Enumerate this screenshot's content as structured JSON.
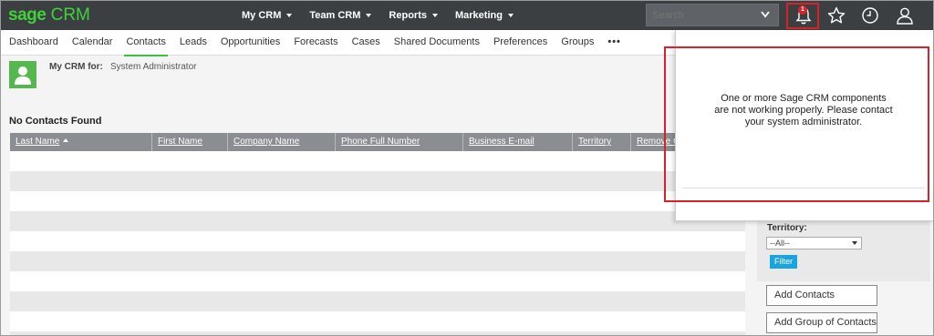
{
  "app": {
    "brand_sage": "sage",
    "brand_crm": "CRM"
  },
  "topmenu": [
    {
      "label": "My CRM"
    },
    {
      "label": "Team CRM"
    },
    {
      "label": "Reports"
    },
    {
      "label": "Marketing"
    }
  ],
  "search": {
    "placeholder": "Search"
  },
  "notifications": {
    "count": "1",
    "message": "One or more Sage CRM components are not working properly. Please contact your system administrator."
  },
  "tabs": [
    {
      "label": "Dashboard"
    },
    {
      "label": "Calendar"
    },
    {
      "label": "Contacts"
    },
    {
      "label": "Leads"
    },
    {
      "label": "Opportunities"
    },
    {
      "label": "Forecasts"
    },
    {
      "label": "Cases"
    },
    {
      "label": "Shared Documents"
    },
    {
      "label": "Preferences"
    },
    {
      "label": "Groups"
    },
    {
      "label": "•••"
    }
  ],
  "header": {
    "mycrm_for_label": "My CRM for:",
    "user": "System Administrator"
  },
  "list": {
    "title": "No Contacts Found",
    "columns": [
      {
        "label": "Last Name"
      },
      {
        "label": "First Name"
      },
      {
        "label": "Company Name"
      },
      {
        "label": "Phone Full Number"
      },
      {
        "label": "Business E-mail"
      },
      {
        "label": "Territory"
      },
      {
        "label": "Remove C"
      }
    ]
  },
  "filter": {
    "territory_label": "Territory:",
    "territory_value": "--All--",
    "filter_button": "Filter"
  },
  "actions": {
    "add_contacts": "Add Contacts",
    "add_group": "Add Group of Contacts"
  },
  "colors": {
    "topbar": "#3c3f42",
    "brand": "#41d13c",
    "accent": "#19a4e0",
    "highlight": "#d6232a"
  },
  "icons": [
    "bell-icon",
    "star-icon",
    "clock-icon",
    "user-icon",
    "chevron-down-icon",
    "avatar-icon",
    "sort-up-icon"
  ]
}
